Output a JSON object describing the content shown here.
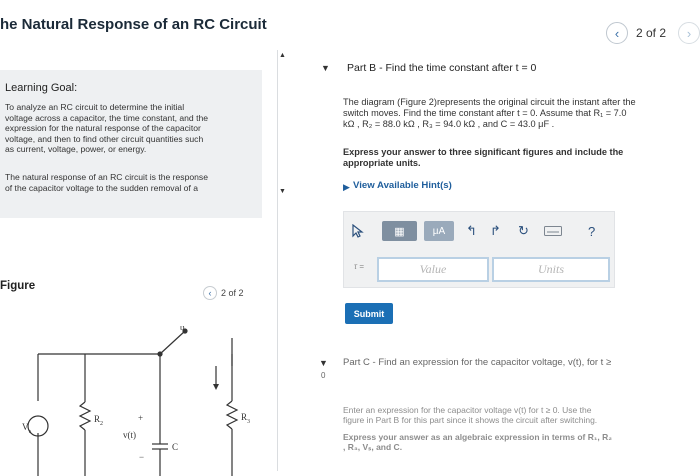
{
  "header": {
    "title": "he Natural Response of an RC Circuit",
    "pager": {
      "text": "2 of 2",
      "prev_icon": "‹",
      "next_icon": "›"
    }
  },
  "left": {
    "goal_heading": "Learning Goal:",
    "goal_paragraph_lines": [
      "To analyze an RC circuit to determine the initial",
      "voltage across a capacitor, the time constant, and the",
      "expression for the natural response of the capacitor",
      "voltage, and then to find other circuit quantities such",
      "as current, voltage, power, or energy."
    ],
    "goal_paragraph2_lines": [
      "The natural response of an RC circuit is the response",
      "of the capacitor voltage to the sudden removal of a"
    ],
    "figure_label": "Figure",
    "figure_pager": {
      "text": "2 of 2",
      "prev_icon": "‹"
    },
    "circuit_labels": {
      "vs": "V",
      "vs_sub": "s",
      "r2": "R",
      "r2_sub": "2",
      "vt": "v(t)",
      "c": "C",
      "r3": "R",
      "r3_sub": "3",
      "b": "b",
      "plus": "+",
      "minus": "−"
    }
  },
  "right": {
    "part_b_title": "Part B - Find the time constant after t = 0",
    "prompt_lines": [
      "The diagram (Figure 2)represents the original circuit the instant after the",
      "switch moves. Find the time constant after t = 0. Assume that R₁ = 7.0",
      "kΩ , R₂ = 88.0 kΩ , R₃ = 94.0 kΩ , and C = 43.0 μF ."
    ],
    "instruction_lines": [
      "Express your answer to three significant figures and include the",
      "appropriate units."
    ],
    "hints_label": "View Available Hint(s)",
    "toolbar": {
      "cursor_icon": "cursor-icon",
      "mu_label": "μA",
      "undo_icon": "↰",
      "redo_icon": "↱",
      "refresh_icon": "↻",
      "help_label": "?"
    },
    "answer": {
      "label": "τ =",
      "value_placeholder": "Value",
      "units_placeholder": "Units"
    },
    "submit_label": "Submit",
    "part_c_title": "Part C - Find an expression for the capacitor voltage, v(t), for t ≥",
    "part_c_lines": [
      "Enter an expression for the capacitor voltage v(t) for t ≥ 0. Use the",
      "figure in Part B for this part since it shows the circuit after switching."
    ],
    "part_c_instr_lines": [
      "Express your answer as an algebraic expression in terms of R₁, R₂",
      ", R₃, Vₛ, and C."
    ],
    "part_c_toggle": "0"
  },
  "colors": {
    "accent": "#1b6fb5",
    "panel": "#eef0f2",
    "link": "#1f5e9c"
  }
}
